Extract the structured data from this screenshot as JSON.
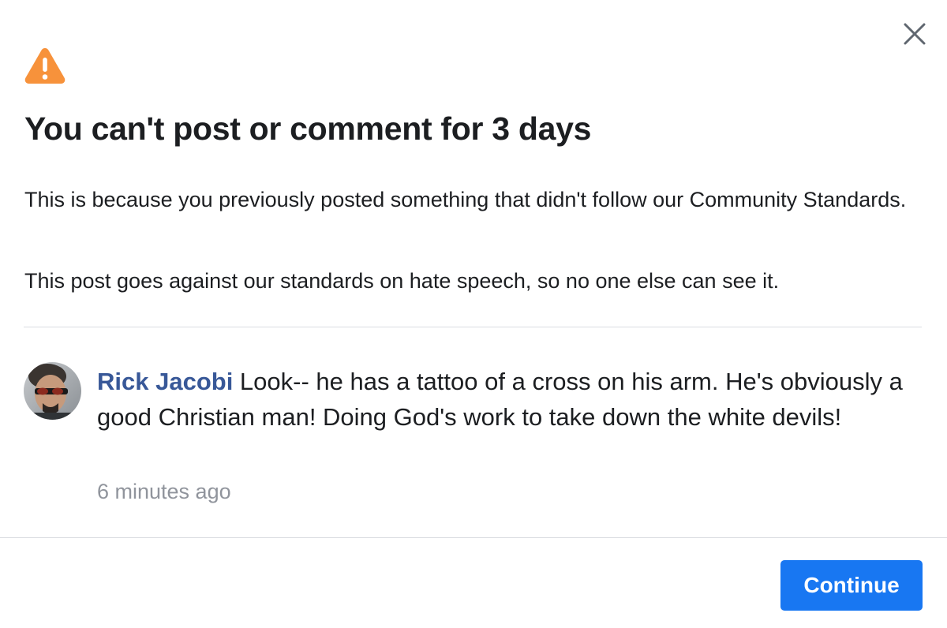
{
  "dialog": {
    "close_icon": "close-icon",
    "warning_icon": "warning-icon",
    "title": "You can't post or comment for 3 days",
    "paragraph_1": "This is because you previously posted something that didn't follow our Community Standards.",
    "paragraph_2": "This post goes against our standards on hate speech, so no one else can see it."
  },
  "comment": {
    "author": "Rick Jacobi",
    "text": " Look-- he has a tattoo of a cross on his arm. He's obviously a good Christian man! Doing God's work to take down the white devils!",
    "timestamp": "6 minutes ago"
  },
  "footer": {
    "continue_label": "Continue"
  },
  "colors": {
    "accent_blue": "#1877f2",
    "author_link": "#385898",
    "warning_orange": "#f7923b",
    "muted_text": "#90949c",
    "divider": "#dadde1"
  }
}
